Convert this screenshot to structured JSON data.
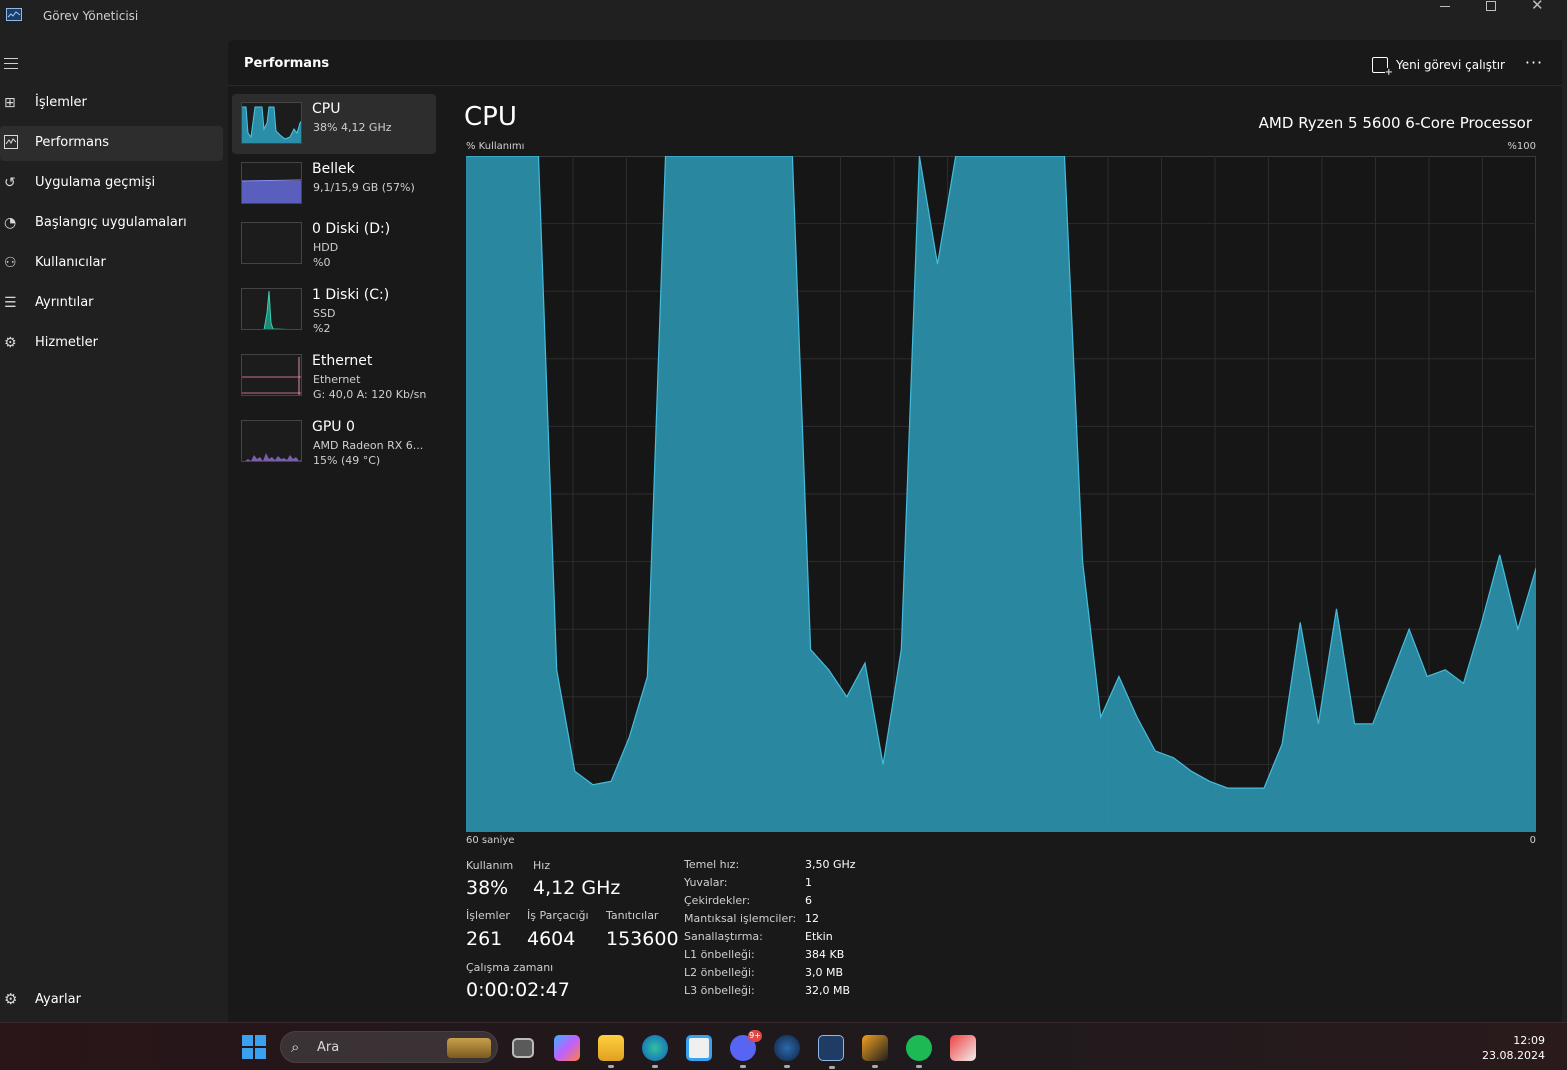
{
  "window": {
    "title": "Görev Yöneticisi",
    "min_icon": "minimize-icon",
    "max_icon": "maximize-icon",
    "close_icon": "close-icon"
  },
  "nav": {
    "items": [
      {
        "label": "İşlemler",
        "icon": "processes-icon"
      },
      {
        "label": "Performans",
        "icon": "performance-icon",
        "active": true
      },
      {
        "label": "Uygulama geçmişi",
        "icon": "history-icon"
      },
      {
        "label": "Başlangıç uygulamaları",
        "icon": "startup-icon"
      },
      {
        "label": "Kullanıcılar",
        "icon": "users-icon"
      },
      {
        "label": "Ayrıntılar",
        "icon": "details-icon"
      },
      {
        "label": "Hizmetler",
        "icon": "services-icon"
      }
    ],
    "settings_label": "Ayarlar"
  },
  "header": {
    "title": "Performans",
    "run_task_label": "Yeni görevi çalıştır",
    "more_label": "···"
  },
  "devices": [
    {
      "name": "CPU",
      "sub1": "38% 4,12 GHz",
      "sub2": ""
    },
    {
      "name": "Bellek",
      "sub1": "9,1/15,9 GB (57%)",
      "sub2": ""
    },
    {
      "name": "0 Diski (D:)",
      "sub1": "HDD",
      "sub2": "%0"
    },
    {
      "name": "1 Diski (C:)",
      "sub1": "SSD",
      "sub2": "%2"
    },
    {
      "name": "Ethernet",
      "sub1": "Ethernet",
      "sub2": "G: 40,0 A: 120 Kb/sn"
    },
    {
      "name": "GPU 0",
      "sub1": "AMD Radeon RX 6...",
      "sub2": "15% (49 °C)"
    }
  ],
  "cpu": {
    "title": "CPU",
    "model": "AMD Ryzen 5 5600 6-Core Processor",
    "graph_ylabel": "% Kullanımı",
    "graph_ymax": "%100",
    "graph_xlabel": "60 saniye",
    "graph_xmin": "0",
    "stats": {
      "usage_label": "Kullanım",
      "usage_value": "38%",
      "speed_label": "Hız",
      "speed_value": "4,12 GHz",
      "processes_label": "İşlemler",
      "processes_value": "261",
      "threads_label": "İş Parçacığı",
      "threads_value": "4604",
      "handles_label": "Tanıtıcılar",
      "handles_value": "153600",
      "uptime_label": "Çalışma zamanı",
      "uptime_value": "0:00:02:47"
    },
    "specs": [
      {
        "key": "Temel hız:",
        "value": "3,50 GHz"
      },
      {
        "key": "Yuvalar:",
        "value": "1"
      },
      {
        "key": "Çekirdekler:",
        "value": "6"
      },
      {
        "key": "Mantıksal işlemciler:",
        "value": "12"
      },
      {
        "key": "Sanallaştırma:",
        "value": "Etkin"
      },
      {
        "key": "L1 önbelleği:",
        "value": "384 KB"
      },
      {
        "key": "L2 önbelleği:",
        "value": "3,0 MB"
      },
      {
        "key": "L3 önbelleği:",
        "value": "32,0 MB"
      }
    ]
  },
  "chart_data": {
    "type": "area",
    "ylim": [
      0,
      100
    ],
    "xlim": [
      0,
      60
    ],
    "grid": true,
    "color": "#2a8ea8",
    "values": [
      100,
      100,
      100,
      100,
      100,
      24,
      9,
      7,
      7.5,
      14,
      23,
      100,
      100,
      100,
      100,
      100,
      100,
      100,
      100,
      27,
      24,
      20,
      25,
      10,
      27,
      100,
      84,
      100,
      100,
      100,
      100,
      100,
      100,
      100,
      40,
      17,
      23,
      17,
      12,
      11,
      9,
      7.5,
      6.5,
      6.5,
      6.5,
      13,
      31,
      16,
      33,
      16,
      16,
      23,
      30,
      23,
      24,
      22,
      31,
      41,
      30,
      39
    ]
  },
  "taskbar": {
    "search_placeholder": "Ara",
    "time": "12:09",
    "date": "23.08.2024",
    "discord_badge": "9+",
    "apps": [
      "task-view-icon",
      "copilot-icon",
      "file-explorer-icon",
      "edge-icon",
      "store-icon",
      "discord-icon",
      "steam-icon",
      "task-manager-icon",
      "mail-icon",
      "spotify-icon",
      "snipping-tool-icon"
    ]
  }
}
